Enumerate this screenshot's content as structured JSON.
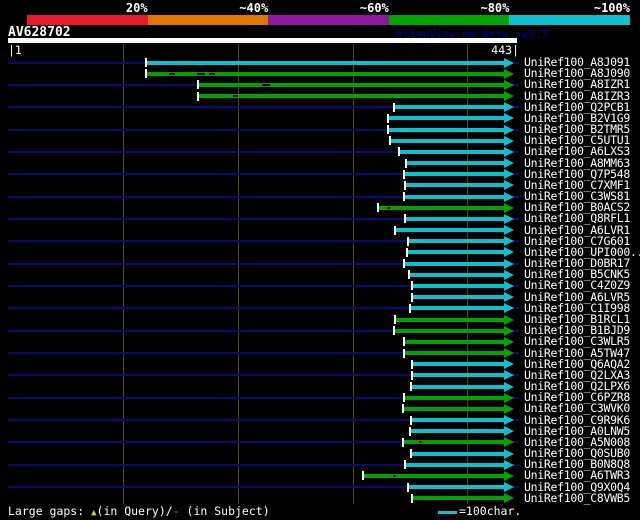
{
  "header": {
    "title": "AV628702",
    "watermark": "AlignView.pm Beta rel.7",
    "scale_segments": [
      {
        "label": "20%",
        "color": "#e8192c"
      },
      {
        "label": "~40%",
        "color": "#dd7700"
      },
      {
        "label": "~60%",
        "color": "#8e189e"
      },
      {
        "label": "~80%",
        "color": "#00a300"
      },
      {
        "label": "~100%",
        "color": "#0cc0ce"
      }
    ]
  },
  "scale": {
    "left_label": "|1",
    "right_label": "443|",
    "gridline_xs": [
      123,
      238,
      353,
      467
    ]
  },
  "colors": {
    "cyan": "#0cc0ce",
    "green": "#00a300",
    "query_line": "#0b0b78",
    "gridline": "#4e4e00",
    "gap_symbol_yellow": "#d8d800"
  },
  "rows": [
    {
      "label": "UniRef100_A8J091",
      "color": "cyan",
      "start": 146,
      "query_line": true,
      "gaps": []
    },
    {
      "label": "UniRef100_A8J090",
      "color": "green",
      "start": 146,
      "query_line": false,
      "gaps": [
        [
          169,
          6
        ],
        [
          197,
          8
        ],
        [
          209,
          6
        ]
      ]
    },
    {
      "label": "UniRef100_A8IZR1",
      "color": "green",
      "start": 198,
      "query_line": true,
      "gaps": [
        [
          262,
          8
        ]
      ]
    },
    {
      "label": "UniRef100_A8IZR3",
      "color": "green",
      "start": 198,
      "query_line": false,
      "gaps": [
        [
          233,
          5
        ]
      ]
    },
    {
      "label": "UniRef100_Q2PCB1",
      "color": "cyan",
      "start": 394,
      "query_line": true,
      "gaps": []
    },
    {
      "label": "UniRef100_B2V1G9",
      "color": "cyan",
      "start": 388,
      "query_line": false,
      "gaps": []
    },
    {
      "label": "UniRef100_B2TMR5",
      "color": "cyan",
      "start": 388,
      "query_line": true,
      "gaps": []
    },
    {
      "label": "UniRef100_C5UTU1",
      "color": "cyan",
      "start": 390,
      "query_line": false,
      "gaps": []
    },
    {
      "label": "UniRef100_A6LXS3",
      "color": "cyan",
      "start": 399,
      "query_line": true,
      "gaps": []
    },
    {
      "label": "UniRef100_A8MM63",
      "color": "cyan",
      "start": 406,
      "query_line": false,
      "gaps": []
    },
    {
      "label": "UniRef100_Q7P548",
      "color": "cyan",
      "start": 404,
      "query_line": true,
      "gaps": []
    },
    {
      "label": "UniRef100_C7XMF1",
      "color": "cyan",
      "start": 405,
      "query_line": false,
      "gaps": []
    },
    {
      "label": "UniRef100_C3WS81",
      "color": "cyan",
      "start": 404,
      "query_line": true,
      "gaps": []
    },
    {
      "label": "UniRef100_B0ACS2",
      "color": "green",
      "start": 378,
      "query_line": false,
      "gaps": [
        [
          387,
          3
        ]
      ]
    },
    {
      "label": "UniRef100_Q8RFL1",
      "color": "cyan",
      "start": 405,
      "query_line": true,
      "gaps": []
    },
    {
      "label": "UniRef100_A6LVR1",
      "color": "cyan",
      "start": 395,
      "query_line": false,
      "gaps": []
    },
    {
      "label": "UniRef100_C7G601",
      "color": "cyan",
      "start": 408,
      "query_line": true,
      "gaps": []
    },
    {
      "label": "UniRef100_UPI000..",
      "color": "cyan",
      "start": 407,
      "query_line": false,
      "gaps": []
    },
    {
      "label": "UniRef100_D0BR17",
      "color": "cyan",
      "start": 404,
      "query_line": true,
      "gaps": []
    },
    {
      "label": "UniRef100_B5CNK5",
      "color": "cyan",
      "start": 409,
      "query_line": false,
      "gaps": []
    },
    {
      "label": "UniRef100_C4Z0Z9",
      "color": "cyan",
      "start": 412,
      "query_line": true,
      "gaps": []
    },
    {
      "label": "UniRef100_A6LVR5",
      "color": "cyan",
      "start": 412,
      "query_line": false,
      "gaps": []
    },
    {
      "label": "UniRef100_C1I998",
      "color": "cyan",
      "start": 410,
      "query_line": true,
      "gaps": []
    },
    {
      "label": "UniRef100_B1RCL1",
      "color": "green",
      "start": 395,
      "query_line": false,
      "gaps": []
    },
    {
      "label": "UniRef100_B1BJD9",
      "color": "green",
      "start": 394,
      "query_line": true,
      "gaps": []
    },
    {
      "label": "UniRef100_C3WLR5",
      "color": "green",
      "start": 404,
      "query_line": false,
      "gaps": []
    },
    {
      "label": "UniRef100_A5TW47",
      "color": "green",
      "start": 404,
      "query_line": true,
      "gaps": []
    },
    {
      "label": "UniRef100_Q6AQA2",
      "color": "cyan",
      "start": 412,
      "query_line": false,
      "gaps": []
    },
    {
      "label": "UniRef100_Q2LXA3",
      "color": "cyan",
      "start": 412,
      "query_line": true,
      "gaps": []
    },
    {
      "label": "UniRef100_Q2LPX6",
      "color": "cyan",
      "start": 411,
      "query_line": false,
      "gaps": []
    },
    {
      "label": "UniRef100_C6PZR8",
      "color": "green",
      "start": 404,
      "query_line": true,
      "gaps": []
    },
    {
      "label": "UniRef100_C3WVK0",
      "color": "green",
      "start": 403,
      "query_line": false,
      "gaps": []
    },
    {
      "label": "UniRef100_C9R9K6",
      "color": "cyan",
      "start": 411,
      "query_line": true,
      "gaps": []
    },
    {
      "label": "UniRef100_A0LNW5",
      "color": "cyan",
      "start": 410,
      "query_line": false,
      "gaps": []
    },
    {
      "label": "UniRef100_A5N008",
      "color": "green",
      "start": 403,
      "query_line": true,
      "gaps": [
        [
          419,
          3
        ]
      ]
    },
    {
      "label": "UniRef100_Q0SUB0",
      "color": "cyan",
      "start": 411,
      "query_line": false,
      "gaps": []
    },
    {
      "label": "UniRef100_B0N8Q8",
      "color": "cyan",
      "start": 405,
      "query_line": true,
      "gaps": []
    },
    {
      "label": "UniRef100_A6TWR3",
      "color": "green",
      "start": 363,
      "query_line": false,
      "gaps": [
        [
          393,
          3
        ]
      ]
    },
    {
      "label": "UniRef100_Q9X0Q4",
      "color": "cyan",
      "start": 408,
      "query_line": true,
      "gaps": []
    },
    {
      "label": "UniRef100_C8VWB5",
      "color": "green",
      "start": 412,
      "query_line": false,
      "gaps": []
    }
  ],
  "footer": {
    "prefix": "Large gaps: ",
    "query_symbol": "▲",
    "query_text": "(in Query)/",
    "subject_symbol": "-",
    "subject_text": " (in Subject)",
    "legend_label": "=100char."
  }
}
